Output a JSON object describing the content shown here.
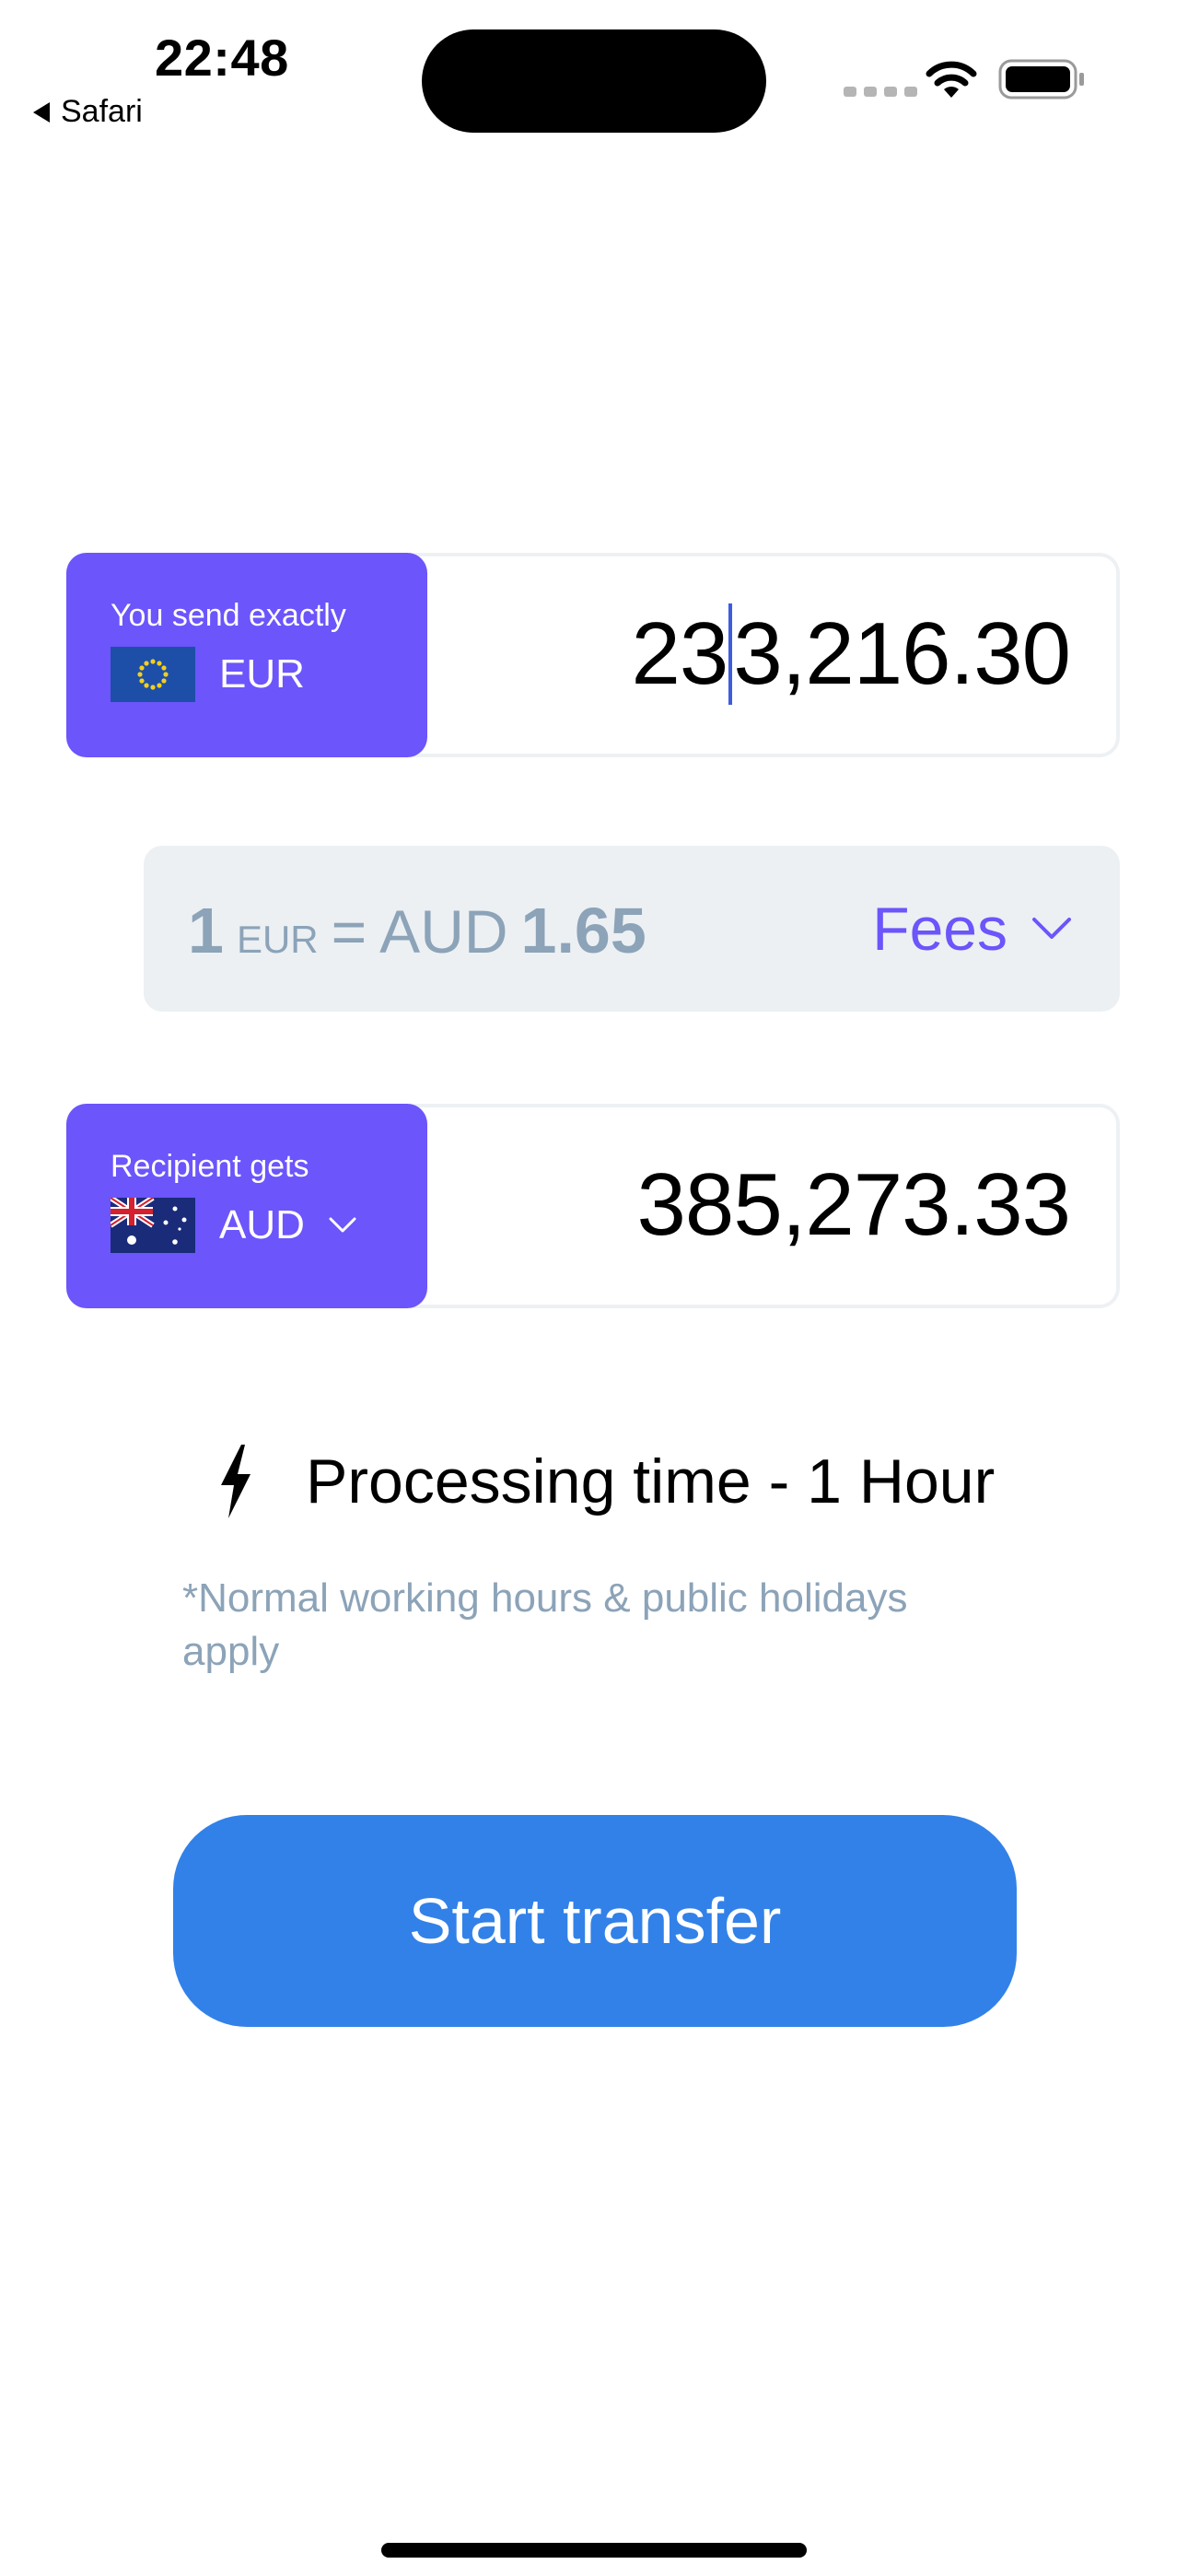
{
  "status_bar": {
    "time": "22:48",
    "back_app": "Safari",
    "icons": [
      "signal-icon",
      "wifi-icon",
      "battery-icon"
    ]
  },
  "send": {
    "caption": "You send exactly",
    "currency": "EUR",
    "flag": "eu-flag-icon",
    "amount_before_caret": "23",
    "amount_after_caret": "3,216.30"
  },
  "rate": {
    "base_amount": "1",
    "base_currency": "EUR",
    "equals": "=",
    "quote_currency": "AUD",
    "quote_amount": "1.65",
    "fees_label": "Fees"
  },
  "receive": {
    "caption": "Recipient gets",
    "currency": "AUD",
    "flag": "au-flag-icon",
    "amount": "385,273.33"
  },
  "processing": {
    "icon": "lightning-icon",
    "text": "Processing time - 1 Hour",
    "disclaimer": "*Normal working hours & public holidays apply"
  },
  "actions": {
    "start_transfer": "Start transfer"
  },
  "colors": {
    "accent": "#6b55fb",
    "button": "#3281e8",
    "muted_text": "#8ca3b8",
    "rate_bg": "#ecf0f3",
    "caret": "#3d5ce0"
  }
}
